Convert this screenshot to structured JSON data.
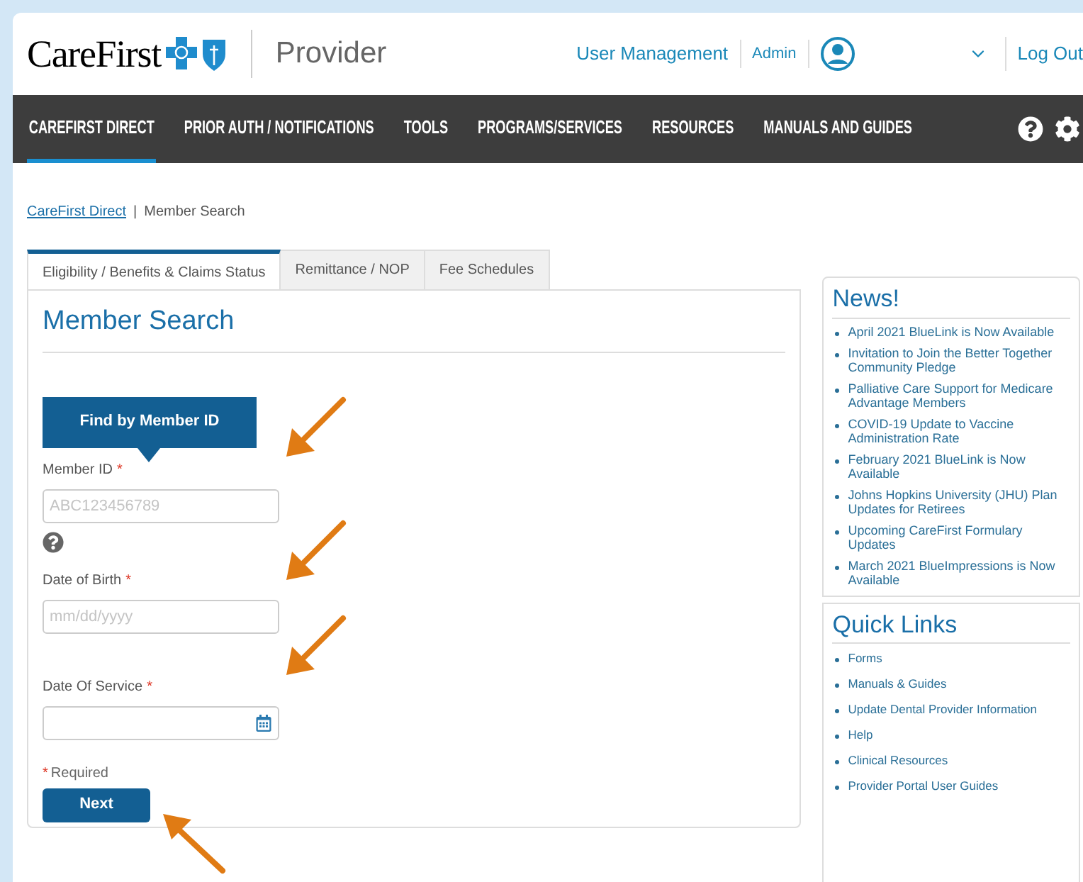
{
  "header": {
    "logo_text": "CareFirst",
    "product": "Provider",
    "links": [
      "User Management",
      "Admin"
    ],
    "logout": "Log Out"
  },
  "nav": {
    "items": [
      {
        "label": "CAREFIRST DIRECT",
        "selected": true
      },
      {
        "label": "PRIOR AUTH / NOTIFICATIONS",
        "selected": false
      },
      {
        "label": "TOOLS",
        "selected": false
      },
      {
        "label": "PROGRAMS/SERVICES",
        "selected": false
      },
      {
        "label": "RESOURCES",
        "selected": false
      },
      {
        "label": "MANUALS AND GUIDES",
        "selected": false
      }
    ]
  },
  "breadcrumb": {
    "link": "CareFirst Direct",
    "separator": "|",
    "current": "Member Search"
  },
  "tabs": [
    {
      "label": "Eligibility / Benefits & Claims Status",
      "selected": true
    },
    {
      "label": "Remittance / NOP",
      "selected": false
    },
    {
      "label": "Fee Schedules",
      "selected": false
    }
  ],
  "form": {
    "title": "Member Search",
    "mode_button": "Find by Member ID",
    "fields": [
      {
        "label": "Member ID",
        "required_mark": "*",
        "placeholder": "ABC123456789",
        "kind": "text",
        "help": true
      },
      {
        "label": "Date of Birth",
        "required_mark": "*",
        "placeholder": "mm/dd/yyyy",
        "kind": "text",
        "help": false
      },
      {
        "label": "Date Of Service",
        "required_mark": "*",
        "kind": "date",
        "help": false
      }
    ],
    "required_note_mark": "*",
    "required_note": "Required",
    "submit": "Next"
  },
  "news": {
    "title": "News!",
    "items": [
      "April 2021 BlueLink is Now Available",
      "Invitation to Join the Better Together Community Pledge",
      "Palliative Care Support for Medicare Advantage Members",
      "COVID-19 Update to Vaccine Administration Rate",
      "February 2021 BlueLink is Now Available",
      "Johns Hopkins University (JHU) Plan Updates for Retirees",
      "Upcoming CareFirst Formulary Updates",
      "March 2021 BlueImpressions is Now Available"
    ]
  },
  "quick_links": {
    "title": "Quick Links",
    "items": [
      "Forms",
      "Manuals & Guides",
      "Update Dental Provider Information",
      "Help",
      "Clinical Resources",
      "Provider Portal User Guides"
    ]
  }
}
